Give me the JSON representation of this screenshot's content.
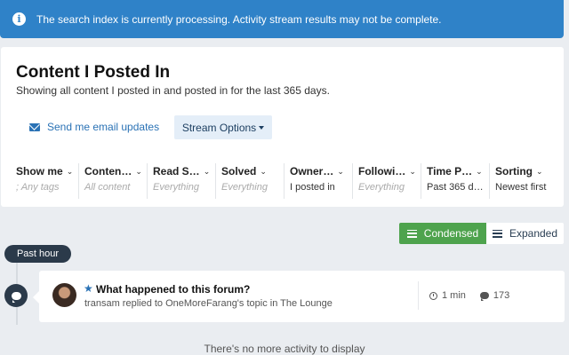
{
  "alert": {
    "message": "The search index is currently processing. Activity stream results may not be complete."
  },
  "header": {
    "title": "Content I Posted In",
    "subtitle": "Showing all content I posted in and posted in for the last 365 days."
  },
  "actions": {
    "email_label": "Send me email updates",
    "stream_options_label": "Stream Options"
  },
  "filters": [
    {
      "label": "Show me",
      "value": "; Any tags",
      "set": false
    },
    {
      "label": "Conten…",
      "value": "All content",
      "set": false
    },
    {
      "label": "Read S…",
      "value": "Everything",
      "set": false
    },
    {
      "label": "Solved",
      "value": "Everything",
      "set": false
    },
    {
      "label": "Owner…",
      "value": "I posted in",
      "set": true
    },
    {
      "label": "Followi…",
      "value": "Everything",
      "set": false
    },
    {
      "label": "Time P…",
      "value": "Past 365 d…",
      "set": true
    },
    {
      "label": "Sorting",
      "value": "Newest first",
      "set": true
    }
  ],
  "view": {
    "condensed_label": "Condensed",
    "expanded_label": "Expanded",
    "active": "Condensed"
  },
  "stream": {
    "time_group": "Past hour",
    "items": [
      {
        "title": "What happened to this forum?",
        "subtitle": "transam replied to OneMoreFarang's topic in The Lounge",
        "time": "1 min",
        "replies": "173"
      }
    ],
    "end_message": "There's no more activity to display"
  },
  "colors": {
    "alert_bg": "#2f82c8",
    "accent": "#2a72b5",
    "condensed_active": "#4ea34d",
    "badge_dark": "#2b3a4a"
  }
}
